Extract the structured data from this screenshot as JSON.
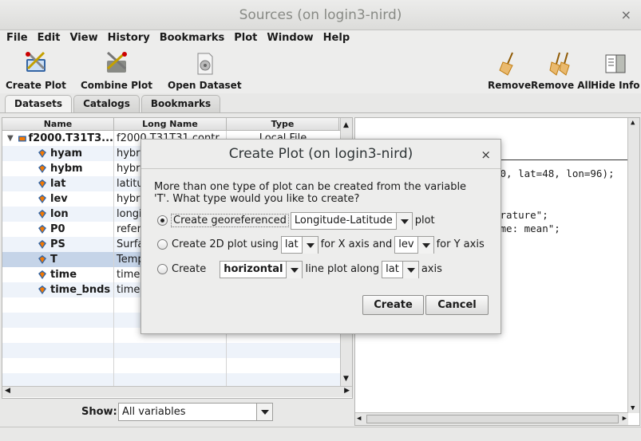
{
  "window": {
    "title": "Sources (on login3-nird)",
    "close_glyph": "×"
  },
  "menu": [
    "File",
    "Edit",
    "View",
    "History",
    "Bookmarks",
    "Plot",
    "Window",
    "Help"
  ],
  "toolbar": {
    "create_plot": "Create Plot",
    "combine_plot": "Combine Plot",
    "open_dataset": "Open Dataset",
    "remove": "Remove",
    "remove_all": "Remove All",
    "hide_info": "Hide Info"
  },
  "tabs": [
    "Datasets",
    "Catalogs",
    "Bookmarks"
  ],
  "table": {
    "headers": [
      "Name",
      "Long Name",
      "Type"
    ],
    "dataset": {
      "name": "f2000.T31T3...",
      "long_name": "f2000.T31T31.contr...",
      "type": "Local File"
    },
    "rows": [
      {
        "name": "hyam",
        "long_name": "hybri"
      },
      {
        "name": "hybm",
        "long_name": "hybri"
      },
      {
        "name": "lat",
        "long_name": "latitu"
      },
      {
        "name": "lev",
        "long_name": "hybri"
      },
      {
        "name": "lon",
        "long_name": "longi"
      },
      {
        "name": "P0",
        "long_name": "refer"
      },
      {
        "name": "PS",
        "long_name": "Surfa"
      },
      {
        "name": "T",
        "long_name": "Temp"
      },
      {
        "name": "time",
        "long_name": "time"
      },
      {
        "name": "time_bnds",
        "long_name": "time"
      }
    ]
  },
  "show": {
    "label": "Show:",
    "value": "All variables"
  },
  "info": {
    "line1": "30, lat=48, lon=96);",
    "line2": "erature\";",
    "line3": "ime: mean\";"
  },
  "dialog": {
    "title": "Create Plot (on login3-nird)",
    "close_glyph": "×",
    "message_line1": "More than one type of plot can be created from the variable",
    "message_line2": "'T'. What type would you like to create?",
    "opt1_label": "Create georeferenced",
    "opt1_combo": "Longitude-Latitude",
    "opt1_suffix": "plot",
    "opt2_label": "Create 2D plot using",
    "opt2_x": "lat",
    "opt2_mid": "for X axis and",
    "opt2_y": "lev",
    "opt2_suffix": "for Y axis",
    "opt3_label": "Create",
    "opt3_combo": "horizontal",
    "opt3_mid": "line plot along",
    "opt3_axis": "lat",
    "opt3_suffix": "axis",
    "create_button": "Create",
    "cancel_button": "Cancel"
  }
}
